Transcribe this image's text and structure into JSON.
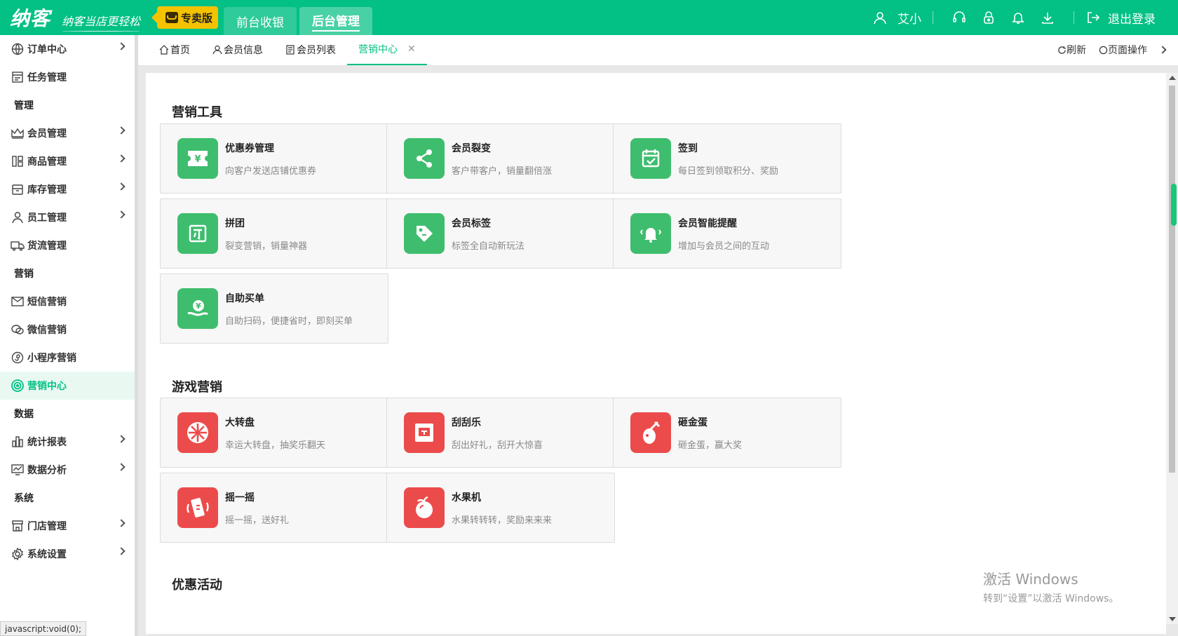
{
  "header": {
    "logo": "纳客",
    "slogan": "纳客当店更轻松",
    "edition": "专卖版",
    "mode_tabs": [
      "前台收银",
      "后台管理"
    ],
    "user": "艾小",
    "logout": "退出登录"
  },
  "sidebar": {
    "items": [
      {
        "label": "订单中心",
        "icon": "globe-icon",
        "chevron": true
      },
      {
        "label": "任务管理",
        "icon": "task-icon",
        "chevron": false
      },
      {
        "group": "管理"
      },
      {
        "label": "会员管理",
        "icon": "crown-icon",
        "chevron": true
      },
      {
        "label": "商品管理",
        "icon": "goods-icon",
        "chevron": true
      },
      {
        "label": "库存管理",
        "icon": "inventory-icon",
        "chevron": true
      },
      {
        "label": "员工管理",
        "icon": "person-icon",
        "chevron": true
      },
      {
        "label": "货流管理",
        "icon": "truck-icon",
        "chevron": false
      },
      {
        "group": "营销"
      },
      {
        "label": "短信营销",
        "icon": "mail-icon",
        "chevron": false
      },
      {
        "label": "微信营销",
        "icon": "wechat-icon",
        "chevron": false
      },
      {
        "label": "小程序营销",
        "icon": "mini-program-icon",
        "chevron": false
      },
      {
        "label": "营销中心",
        "icon": "target-icon",
        "chevron": false,
        "active": true
      },
      {
        "group": "数据"
      },
      {
        "label": "统计报表",
        "icon": "bar-chart-icon",
        "chevron": true
      },
      {
        "label": "数据分析",
        "icon": "analysis-icon",
        "chevron": true
      },
      {
        "group": "系统"
      },
      {
        "label": "门店管理",
        "icon": "store-icon",
        "chevron": true
      },
      {
        "label": "系统设置",
        "icon": "gear-icon",
        "chevron": true
      }
    ]
  },
  "tabs": {
    "items": [
      {
        "label": "首页",
        "icon": "home-icon"
      },
      {
        "label": "会员信息",
        "icon": "user-icon"
      },
      {
        "label": "会员列表",
        "icon": "list-icon"
      },
      {
        "label": "营销中心",
        "icon": "",
        "active": true,
        "closable": true
      }
    ],
    "refresh": "刷新",
    "page_ops": "页面操作"
  },
  "sections": [
    {
      "title": "营销工具",
      "cards": [
        {
          "title": "优惠券管理",
          "desc": "向客户发送店铺优惠券",
          "icon": "coupon-icon",
          "color": "green"
        },
        {
          "title": "会员裂变",
          "desc": "客户带客户，销量翻倍涨",
          "icon": "share-icon",
          "color": "green"
        },
        {
          "title": "签到",
          "desc": "每日签到领取积分、奖励",
          "icon": "calendar-check-icon",
          "color": "green"
        },
        {
          "title": "拼团",
          "desc": "裂变营销，销量神器",
          "icon": "group-buy-icon",
          "color": "green"
        },
        {
          "title": "会员标签",
          "desc": "标签全自动新玩法",
          "icon": "tag-icon",
          "color": "green"
        },
        {
          "title": "会员智能提醒",
          "desc": "增加与会员之间的互动",
          "icon": "bell-icon",
          "color": "green"
        },
        {
          "title": "自助买单",
          "desc": "自助扫码，便捷省时，即刻买单",
          "icon": "self-pay-icon",
          "color": "green"
        }
      ]
    },
    {
      "title": "游戏营销",
      "cards": [
        {
          "title": "大转盘",
          "desc": "幸运大转盘，抽奖乐翻天",
          "icon": "wheel-icon",
          "color": "red"
        },
        {
          "title": "刮刮乐",
          "desc": "刮出好礼，刮开大惊喜",
          "icon": "scratch-card-icon",
          "color": "red"
        },
        {
          "title": "砸金蛋",
          "desc": "砸金蛋，赢大奖",
          "icon": "golden-egg-icon",
          "color": "red"
        },
        {
          "title": "摇一摇",
          "desc": "摇一摇，送好礼",
          "icon": "shake-icon",
          "color": "red"
        },
        {
          "title": "水果机",
          "desc": "水果转转转，奖励来来来",
          "icon": "fruit-machine-icon",
          "color": "red"
        }
      ]
    },
    {
      "title": "优惠活动",
      "cards": []
    }
  ],
  "status_bar": "javascript:void(0);",
  "watermark": {
    "line1": "激活 Windows",
    "line2": "转到“设置”以激活 Windows。"
  },
  "colors": {
    "brand": "#03c084",
    "edition": "#f5c200",
    "card_green": "#3ebd6e",
    "card_red": "#ec4b4b"
  }
}
